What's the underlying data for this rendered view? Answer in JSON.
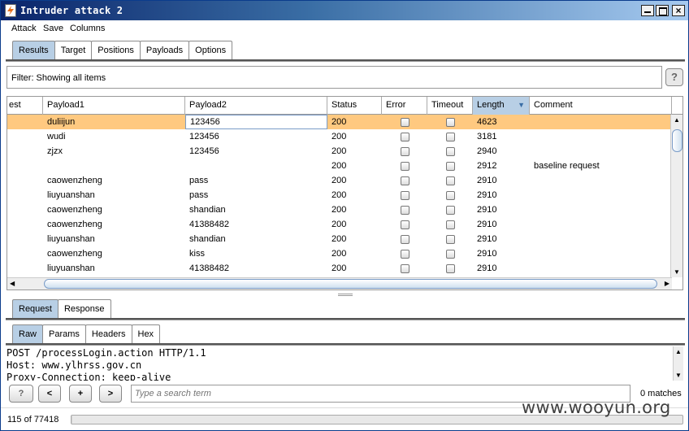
{
  "window": {
    "title": "Intruder attack 2"
  },
  "menu": [
    "Attack",
    "Save",
    "Columns"
  ],
  "main_tabs": [
    {
      "label": "Results",
      "selected": true
    },
    {
      "label": "Target"
    },
    {
      "label": "Positions"
    },
    {
      "label": "Payloads"
    },
    {
      "label": "Options"
    }
  ],
  "filter": {
    "text": "Filter:  Showing all items"
  },
  "help_label": "?",
  "table": {
    "columns": [
      "est",
      "Payload1",
      "Payload2",
      "Status",
      "Error",
      "Timeout",
      "Length",
      "Comment"
    ],
    "sorted_column": "Length",
    "rows": [
      {
        "payload1": "duliijun",
        "payload2": "123456",
        "status": "200",
        "length": "4623",
        "comment": "",
        "selected": true
      },
      {
        "payload1": "wudi",
        "payload2": "123456",
        "status": "200",
        "length": "3181",
        "comment": ""
      },
      {
        "payload1": "zjzx",
        "payload2": "123456",
        "status": "200",
        "length": "2940",
        "comment": ""
      },
      {
        "payload1": "",
        "payload2": "",
        "status": "200",
        "length": "2912",
        "comment": "baseline request"
      },
      {
        "payload1": "caowenzheng",
        "payload2": "pass",
        "status": "200",
        "length": "2910",
        "comment": ""
      },
      {
        "payload1": "liuyuanshan",
        "payload2": "pass",
        "status": "200",
        "length": "2910",
        "comment": ""
      },
      {
        "payload1": "caowenzheng",
        "payload2": "shandian",
        "status": "200",
        "length": "2910",
        "comment": ""
      },
      {
        "payload1": "caowenzheng",
        "payload2": "41388482",
        "status": "200",
        "length": "2910",
        "comment": ""
      },
      {
        "payload1": "liuyuanshan",
        "payload2": "shandian",
        "status": "200",
        "length": "2910",
        "comment": ""
      },
      {
        "payload1": "caowenzheng",
        "payload2": "kiss",
        "status": "200",
        "length": "2910",
        "comment": ""
      },
      {
        "payload1": "liuyuanshan",
        "payload2": "41388482",
        "status": "200",
        "length": "2910",
        "comment": ""
      }
    ]
  },
  "req_tabs": [
    {
      "label": "Request",
      "selected": true
    },
    {
      "label": "Response"
    }
  ],
  "view_tabs": [
    {
      "label": "Raw",
      "selected": true
    },
    {
      "label": "Params"
    },
    {
      "label": "Headers"
    },
    {
      "label": "Hex"
    }
  ],
  "request_lines": [
    "POST /processLogin.action HTTP/1.1",
    "Host: www.ylhrss.gov.cn",
    "Proxy-Connection: keep-alive"
  ],
  "search": {
    "help": "?",
    "prev": "<",
    "add": "+",
    "next": ">",
    "placeholder": "Type a search term",
    "matches": "0 matches"
  },
  "status": {
    "count": "115 of 77418",
    "progress": 0.0015
  },
  "watermark": "www.wooyun.org",
  "colors": {
    "selected_row": "#ffc980",
    "selected_tab": "#b8cfe5",
    "title_bar": "#0a246a"
  }
}
